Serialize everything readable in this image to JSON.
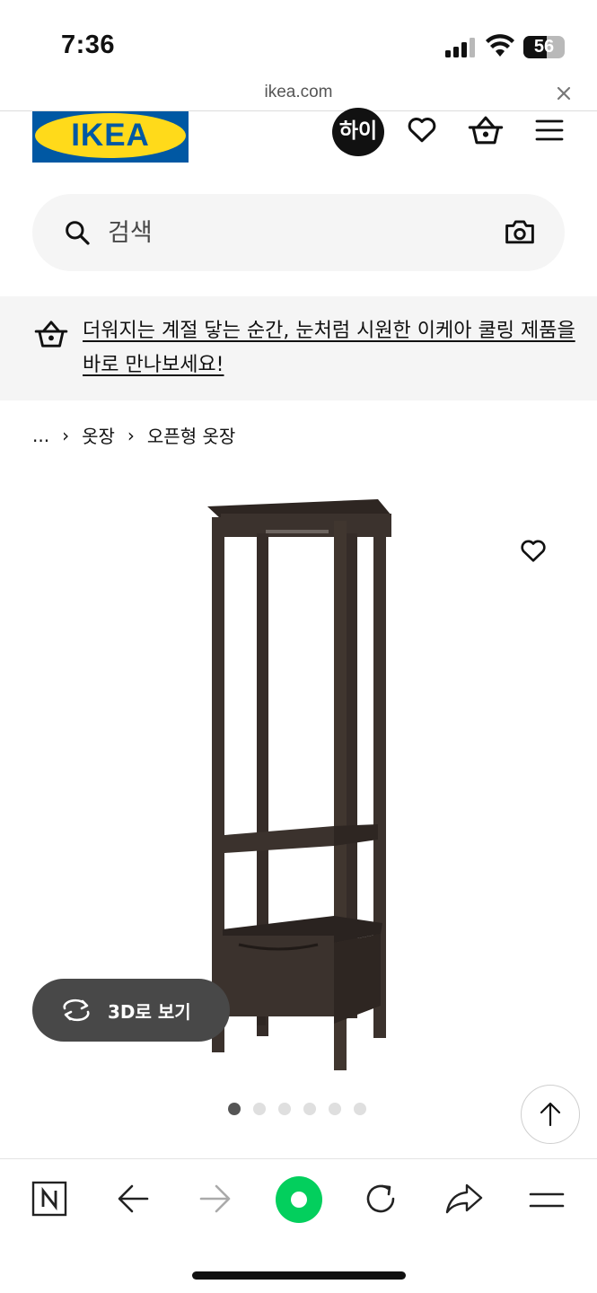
{
  "status_bar": {
    "time": "7:36",
    "battery": "56",
    "battery_level": 0.56
  },
  "url_bar": {
    "domain": "ikea.com",
    "close_icon": "close-icon"
  },
  "header": {
    "logo_text": "IKEA",
    "avatar_text": "하이",
    "icons": [
      "heart-icon",
      "basket-icon",
      "menu-icon"
    ]
  },
  "search": {
    "placeholder": "검색",
    "icon": "search-icon",
    "camera_icon": "camera-icon"
  },
  "banner": {
    "icon": "basket-icon",
    "text": "더워지는 계절 닿는 순간, 눈처럼 시원한 이케아 쿨링 제품을 바로 만나보세요!"
  },
  "breadcrumb": {
    "ellipsis": "...",
    "items": [
      "옷장",
      "오픈형 옷장"
    ],
    "separator": "›"
  },
  "product": {
    "view_3d_label": "3D로 보기",
    "image_count": 6,
    "active_image": 1,
    "colors": {
      "wood": "#3b322d"
    }
  },
  "toolbar": {
    "icons": [
      "naver-icon",
      "back-arrow-icon",
      "forward-arrow-icon",
      "green-dot-icon",
      "reload-icon",
      "share-icon",
      "menu-icon"
    ],
    "accent": "#03cf5d"
  }
}
